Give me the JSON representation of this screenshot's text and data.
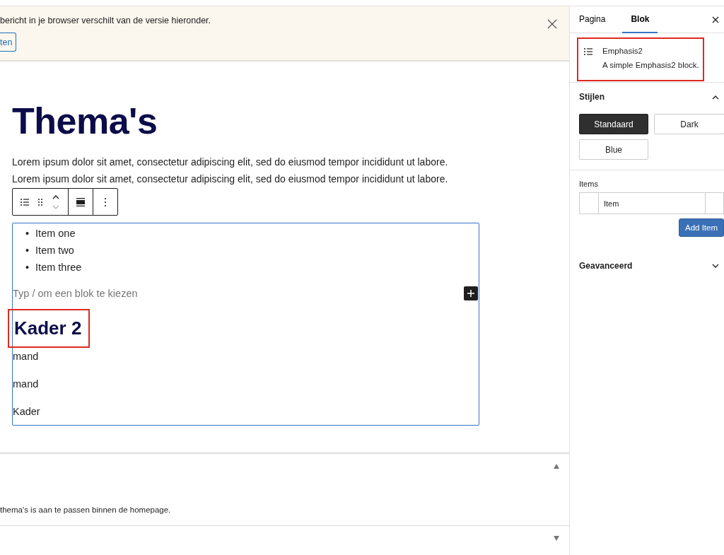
{
  "notice": {
    "message": "bericht in je browser verschilt van de versie hieronder.",
    "button": "ten"
  },
  "editor": {
    "title": "Thema's",
    "paragraphs": [
      "Lorem ipsum dolor sit amet, consectetur adipiscing elit, sed do eiusmod tempor incididunt ut labore.",
      "Lorem ipsum dolor sit amet, consectetur adipiscing elit, sed do eiusmod tempor incididunt ut labore."
    ],
    "block": {
      "list": [
        {
          "marker": "•",
          "text": "Item one"
        },
        {
          "marker": "•",
          "text": "Item two"
        },
        {
          "marker": "•",
          "text": "Item three"
        }
      ],
      "placeholder": "Typ / om een blok te kiezen",
      "heading": "Kader 2",
      "heading_highlighted": true,
      "lines": [
        "mand",
        "mand",
        "Kader"
      ]
    }
  },
  "panels": [
    {
      "expanded": true,
      "text": "thema's is aan te passen binnen de homepage."
    },
    {
      "expanded": false
    }
  ],
  "sidebar": {
    "tabs": [
      {
        "label": "Pagina",
        "selected": false
      },
      {
        "label": "Blok",
        "selected": true
      }
    ],
    "block_card": {
      "title": "Emphasis2",
      "description": "A simple Emphasis2 block.",
      "highlighted": true
    },
    "styles": {
      "title": "Stijlen",
      "expanded": true,
      "options": [
        {
          "label": "Standaard",
          "selected": true
        },
        {
          "label": "Dark",
          "selected": false
        },
        {
          "label": "Blue",
          "selected": false
        }
      ]
    },
    "items": {
      "label": "Items",
      "rows": [
        {
          "value": "Item"
        }
      ],
      "button": "Add Item"
    },
    "advanced": {
      "title": "Geavanceerd",
      "expanded": false
    }
  }
}
